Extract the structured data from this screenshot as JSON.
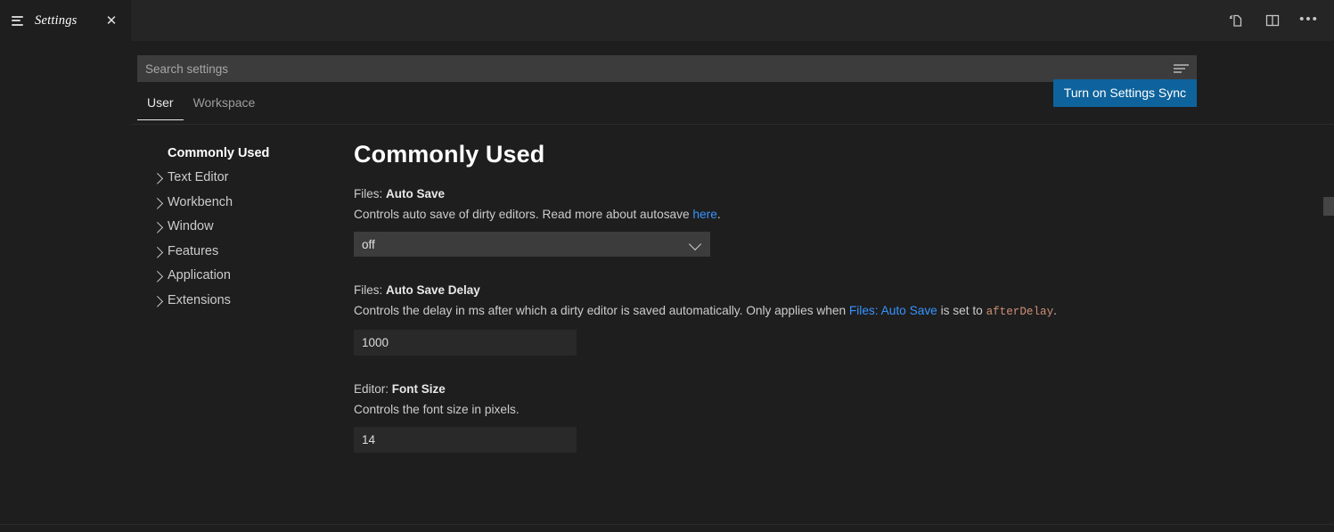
{
  "window": {
    "tab": {
      "title": "Settings",
      "icon": "settings-lines-icon",
      "close_label": "✕"
    },
    "actions": [
      {
        "name": "open-settings-json",
        "label": "Open Settings (JSON)"
      },
      {
        "name": "split-editor",
        "label": "Split Editor"
      },
      {
        "name": "more-actions",
        "label": "•••"
      }
    ]
  },
  "search": {
    "placeholder": "Search settings",
    "value": "",
    "filter_icon": "filter-icon"
  },
  "scope_tabs": [
    {
      "label": "User",
      "active": true
    },
    {
      "label": "Workspace",
      "active": false
    }
  ],
  "sync": {
    "label": "Turn on Settings Sync",
    "color": "#0e639c"
  },
  "toc": {
    "items": [
      {
        "label": "Commonly Used",
        "selected": true,
        "expandable": false
      },
      {
        "label": "Text Editor",
        "selected": false,
        "expandable": true
      },
      {
        "label": "Workbench",
        "selected": false,
        "expandable": true
      },
      {
        "label": "Window",
        "selected": false,
        "expandable": true
      },
      {
        "label": "Features",
        "selected": false,
        "expandable": true
      },
      {
        "label": "Application",
        "selected": false,
        "expandable": true
      },
      {
        "label": "Extensions",
        "selected": false,
        "expandable": true
      }
    ]
  },
  "main": {
    "title": "Commonly Used",
    "settings": [
      {
        "category": "Files: ",
        "name": "Auto Save",
        "desc_before": "Controls auto save of dirty editors. Read more about autosave ",
        "link": "here",
        "desc_after": ".",
        "control": "select",
        "value": "off"
      },
      {
        "category": "Files: ",
        "name": "Auto Save Delay",
        "desc_before": "Controls the delay in ms after which a dirty editor is saved automatically. Only applies when ",
        "link": "Files: Auto Save",
        "desc_mid": " is set to ",
        "code": "afterDelay",
        "desc_after": ".",
        "control": "text",
        "value": "1000"
      },
      {
        "category": "Editor: ",
        "name": "Font Size",
        "desc_before": "Controls the font size in pixels.",
        "control": "text",
        "value": "14"
      }
    ]
  }
}
